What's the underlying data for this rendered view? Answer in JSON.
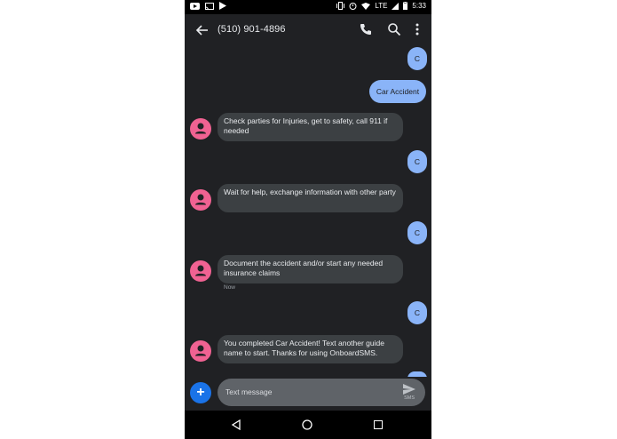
{
  "status_bar": {
    "network": "LTE",
    "time": "5:33",
    "icons": [
      "youtube-icon",
      "cast-icon",
      "play-store-icon",
      "vibrate-icon",
      "alarm-icon",
      "wifi-icon",
      "signal-icon",
      "battery-icon"
    ]
  },
  "app_bar": {
    "title": "(510) 901-4896",
    "icons": [
      "back-arrow-icon",
      "phone-icon",
      "search-icon",
      "more-vert-icon"
    ]
  },
  "messages": [
    {
      "dir": "out",
      "text": "C"
    },
    {
      "dir": "out",
      "text": "Car Accident"
    },
    {
      "dir": "in",
      "text": "Check parties for Injuries, get to safety, call 911 if needed"
    },
    {
      "dir": "out",
      "text": "C"
    },
    {
      "dir": "in",
      "text": "Wait for help, exchange information with other party"
    },
    {
      "dir": "out",
      "text": "C"
    },
    {
      "dir": "in",
      "text": "Document the accident and/or start any needed insurance claims",
      "time": "Now"
    },
    {
      "dir": "out",
      "text": "C"
    },
    {
      "dir": "in",
      "text": "You completed Car Accident! Text another guide name to start. Thanks for using OnboardSMS."
    }
  ],
  "compose": {
    "placeholder": "Text message",
    "send_label": "SMS",
    "add_icon": "plus-icon"
  },
  "colors": {
    "background": "#202124",
    "outgoing_bubble": "#8ab4f8",
    "incoming_bubble": "#3c4043",
    "avatar": "#f06292",
    "fab": "#1a73e8"
  }
}
